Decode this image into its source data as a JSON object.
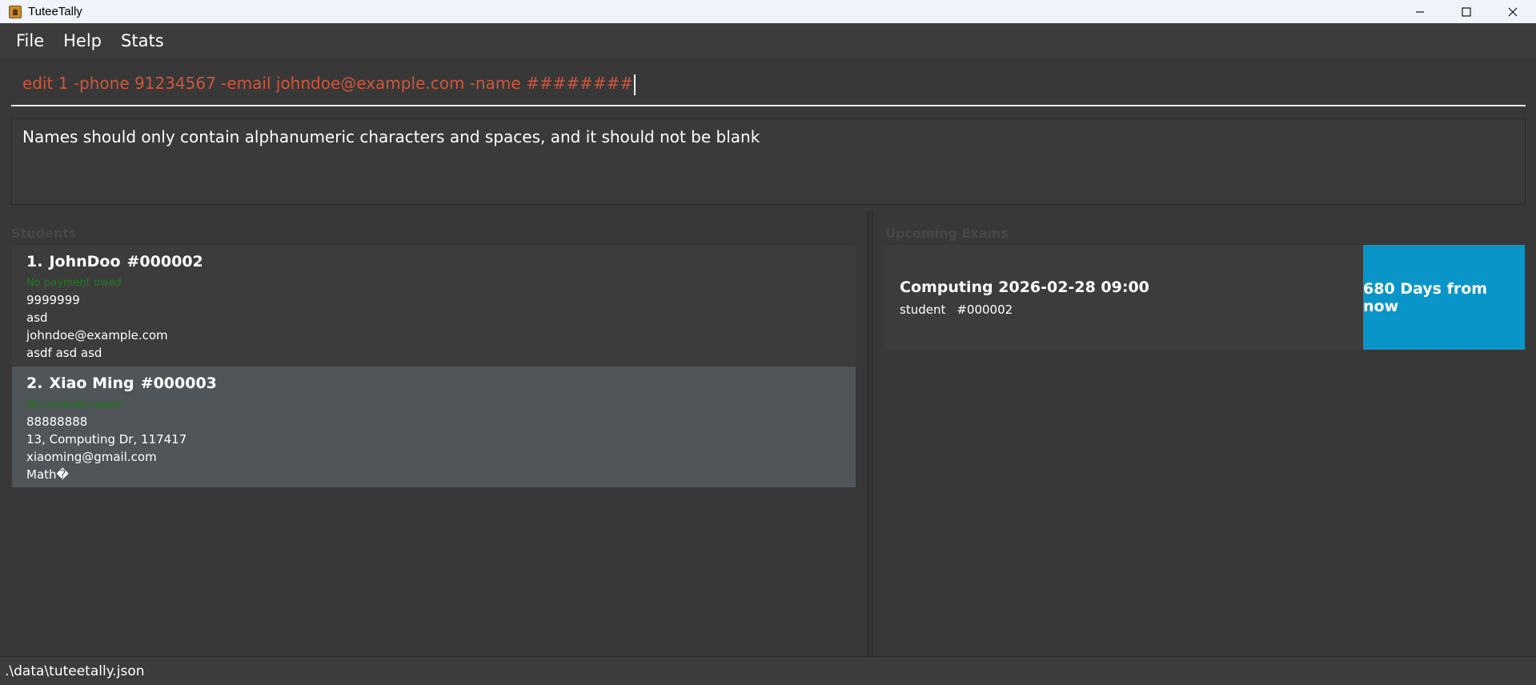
{
  "window": {
    "title": "TuteeTally",
    "icons": {
      "app": "app-icon",
      "minimize": "minimize-icon",
      "maximize": "maximize-icon",
      "close": "close-icon"
    }
  },
  "menu": {
    "items": [
      {
        "label": "File"
      },
      {
        "label": "Help"
      },
      {
        "label": "Stats"
      }
    ]
  },
  "command": {
    "value": "edit 1 -phone 91234567 -email johndoe@example.com -name ########",
    "text_color": "#d0553b"
  },
  "result": {
    "message": "Names should only contain alphanumeric characters and spaces, and it should not be blank"
  },
  "students_panel": {
    "heading": "Students",
    "students": [
      {
        "index": "1.",
        "name": "JohnDoo",
        "id": "#000002",
        "payment": "No payment owed",
        "phone": "9999999",
        "address": "asd",
        "email": "johndoe@example.com",
        "subjects": "asdf asd asd",
        "selected": false
      },
      {
        "index": "2.",
        "name": "Xiao Ming",
        "id": "#000003",
        "payment": "No payment owed",
        "phone": "88888888",
        "address": "13, Computing Dr, 117417",
        "email": "xiaoming@gmail.com",
        "subjects": "Math�",
        "selected": true
      }
    ]
  },
  "exams_panel": {
    "heading": "Upcoming Exams",
    "exams": [
      {
        "title": "Computing 2026-02-28 09:00",
        "student_label": "student",
        "student_id": "#000002",
        "countdown": "680 Days from now",
        "countdown_color": "#0a95c8"
      }
    ]
  },
  "status": {
    "path": ".\\data\\tuteetally.json"
  }
}
